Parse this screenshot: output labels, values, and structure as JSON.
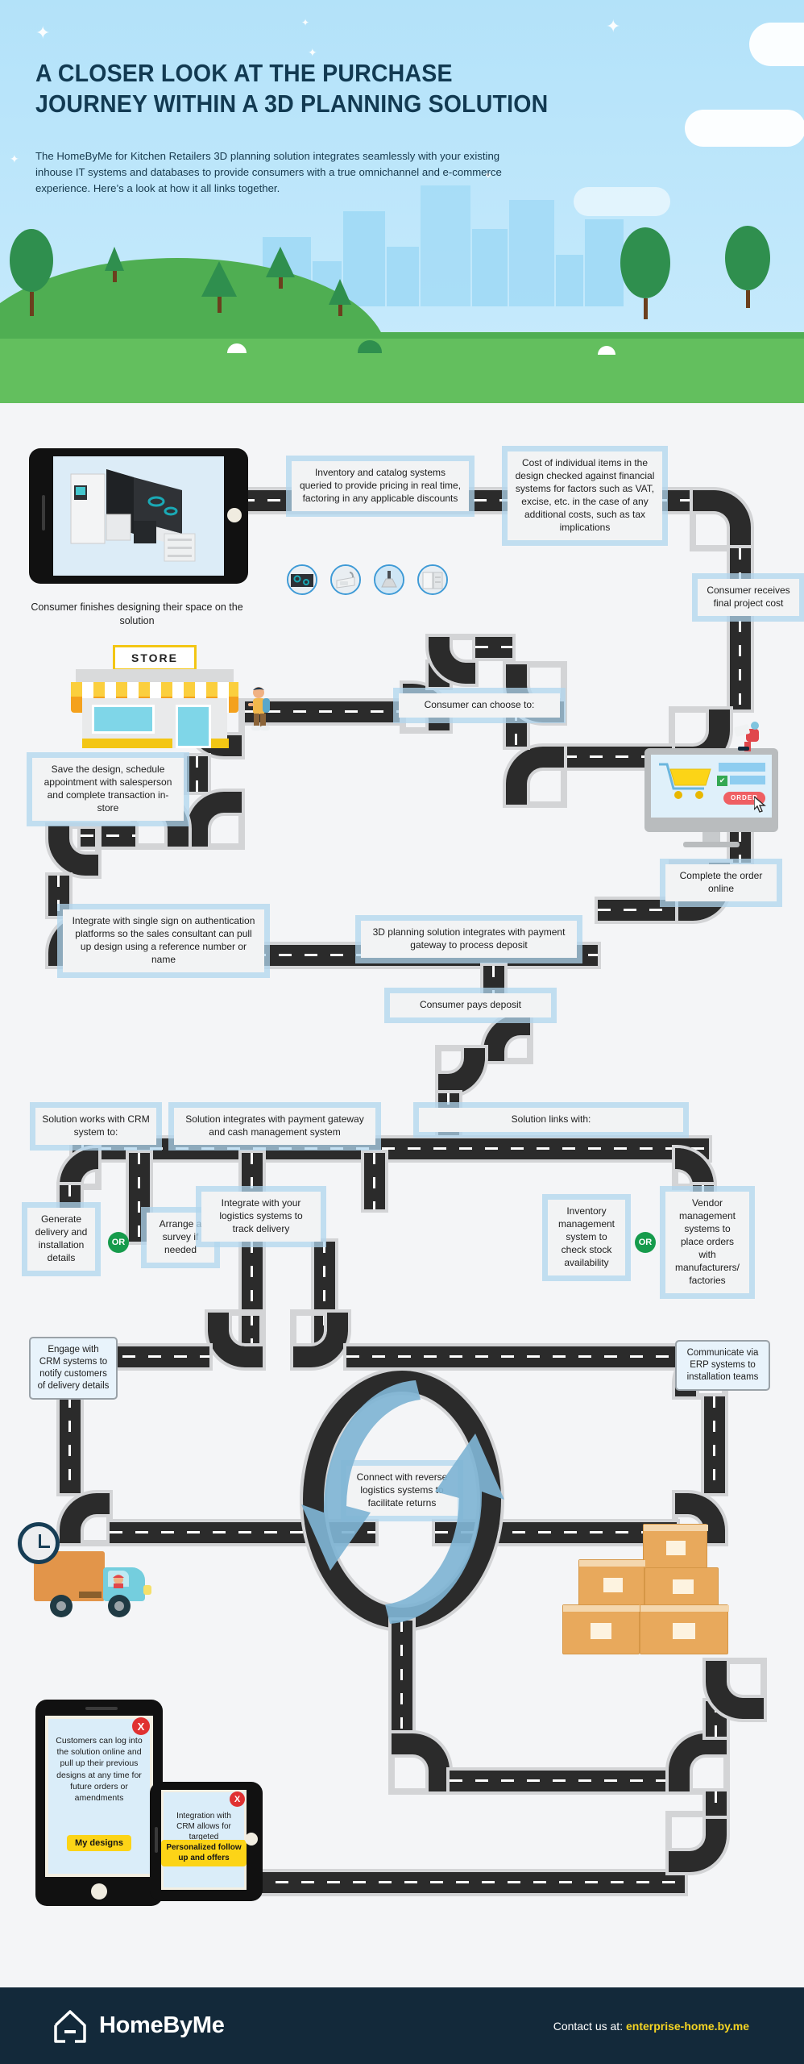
{
  "header": {
    "title_line1": "A CLOSER LOOK AT THE PURCHASE",
    "title_line2": "JOURNEY WITHIN A 3D PLANNING SOLUTION",
    "paragraph": "The HomeByMe for Kitchen Retailers 3D planning solution integrates seamlessly with your existing inhouse IT systems and databases to provide consumers with a true omnichannel and e-commerce experience. Here’s a look at how it all links together.",
    "store_sign": "STORE"
  },
  "flow": {
    "step_tablet_caption": "Consumer finishes designing their space on the solution",
    "step_inventory": "Inventory and catalog systems queried to provide pricing in real time, factoring in any applicable discounts",
    "step_cost": "Cost of individual items in the design checked against financial systems for factors such as VAT, excise, etc. in the case of any additional costs, such as tax implications",
    "step_final_cost": "Consumer receives final project cost",
    "step_choose": "Consumer can choose to:",
    "step_instore": "Save the design, schedule appointment with salesperson and complete transaction in-store",
    "step_online": "Complete the order online",
    "step_sso": "Integrate with single sign on authentication platforms so the sales consultant can pull up design using a reference number or name",
    "step_payment_gateway": "3D planning solution integrates with payment gateway to process deposit",
    "step_deposit": "Consumer pays deposit",
    "step_crm": "Solution works with CRM system to:",
    "step_cash_mgmt": "Solution integrates with payment gateway and cash management system",
    "step_links": "Solution links with:",
    "step_delivery_details": "Generate delivery and installation details",
    "step_survey": "Arrange a survey if needed",
    "step_logistics": "Integrate with your logistics systems to track delivery",
    "step_inventory_mgmt": "Inventory management system to check stock availability",
    "step_vendor_mgmt": "Vendor management systems to place orders with manufacturers/ factories",
    "step_engage_crm": "Engage with CRM systems to notify customers of delivery details",
    "step_erp": "Communicate via ERP systems to installation teams",
    "step_reverse": "Connect with reverse logistics systems to facilitate returns",
    "step_customers_login": "Customers can log into the solution online and pull up their previous designs at any time for future orders or amendments",
    "step_my_designs": "My designs",
    "step_crm_targeted": "Integration with CRM allows for targeted",
    "step_followup": "Personalized follow up and offers",
    "or_label": "OR",
    "close_label": "X",
    "order_button": "ORDER"
  },
  "footer": {
    "brand": "HomeByMe",
    "contact_prefix": "Contact us at: ",
    "contact_link": "enterprise-home.by.me"
  },
  "colors": {
    "sky": "#bfe7fb",
    "headline": "#123a52",
    "road": "#2b2b2b",
    "box_halo": "#b0d6ee",
    "accent_yellow": "#fcd417",
    "footer_bg": "#13293a",
    "green_or": "#169b4c",
    "red_close": "#e03131"
  }
}
